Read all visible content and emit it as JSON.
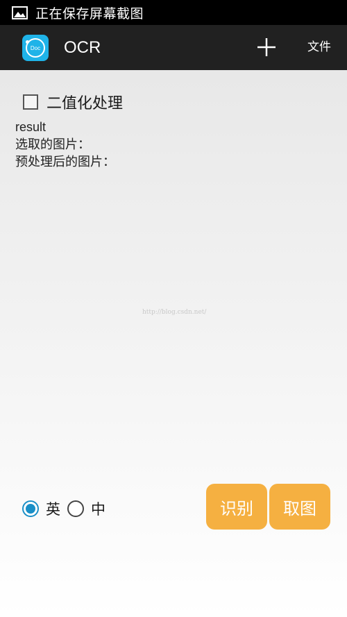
{
  "status_bar": {
    "text": "正在保存屏幕截图",
    "icon": "image-icon"
  },
  "action_bar": {
    "app_icon_label": "Doc",
    "title": "OCR",
    "plus_icon": "plus-icon",
    "file_label": "文件"
  },
  "content": {
    "binarize_label": "二值化处理",
    "binarize_checked": false,
    "result_label": "result",
    "selected_image_label": "选取的图片：",
    "processed_image_label": "预处理后的图片：",
    "watermark": "http://blog.csdn.net/"
  },
  "controls": {
    "lang_english": "英",
    "lang_chinese": "中",
    "selected_lang": "英",
    "recognize_label": "识别",
    "pick_image_label": "取图"
  },
  "colors": {
    "accent_button": "#f5b041",
    "radio_selected": "#1a8fc7",
    "app_icon": "#1fb3e8",
    "action_bar": "#212121"
  }
}
